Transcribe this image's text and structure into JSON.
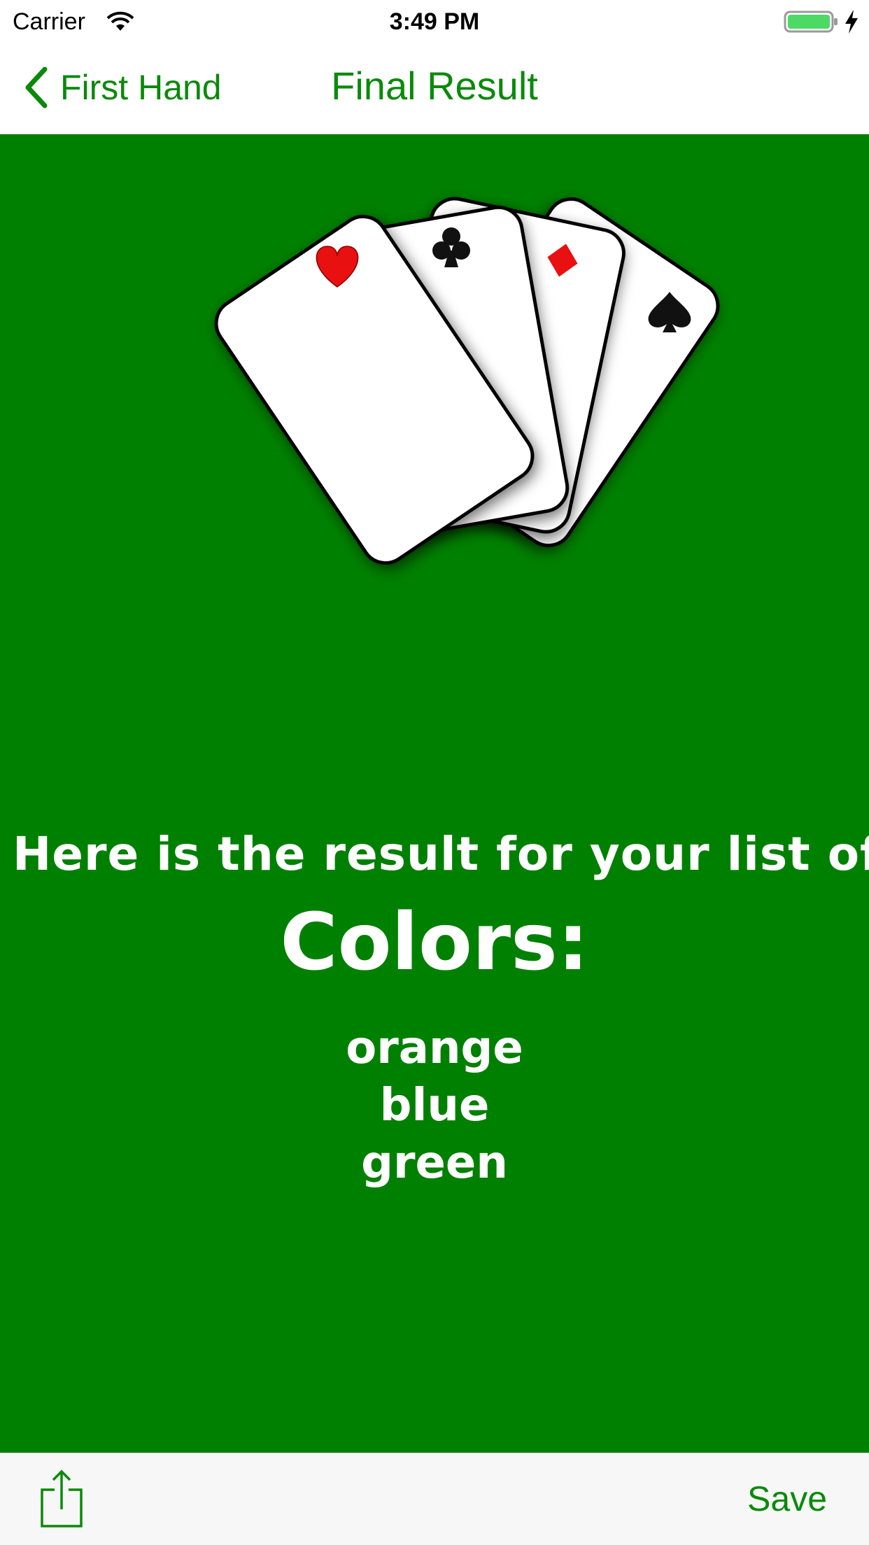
{
  "status_bar": {
    "carrier": "Carrier",
    "time": "3:49 PM",
    "wifi_icon": "wifi-icon",
    "battery_icon": "battery-charging-icon"
  },
  "nav": {
    "back_label": "First Hand",
    "title": "Final Result",
    "back_icon": "chevron-left-icon"
  },
  "cards": {
    "suits": [
      "heart",
      "club",
      "diamond",
      "spade"
    ],
    "suit_colors": {
      "heart": "#e81010",
      "diamond": "#e81010",
      "club": "#111111",
      "spade": "#111111"
    }
  },
  "result": {
    "intro": "Here is the result for your list of",
    "heading": "Colors:",
    "items": [
      "orange",
      "blue",
      "green"
    ]
  },
  "toolbar": {
    "share_icon": "share-icon",
    "save_label": "Save"
  },
  "colors": {
    "accent": "#0a8a0a",
    "felt": "#008000"
  }
}
